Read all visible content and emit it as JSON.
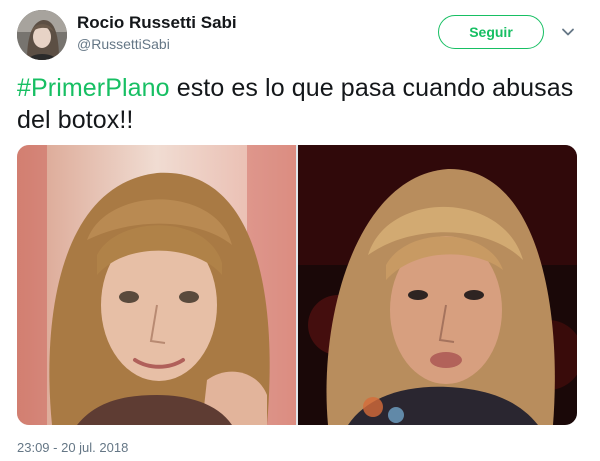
{
  "author": {
    "display_name": "Rocio Russetti Sabi",
    "handle": "@RussettiSabi",
    "avatar_icon": "user-avatar-photo"
  },
  "follow_button": {
    "label": "Seguir"
  },
  "menu": {
    "icon": "chevron-down-icon"
  },
  "tweet": {
    "hashtag": "#PrimerPlano",
    "text": " esto es lo que pasa cuando abusas del botox!!"
  },
  "media": {
    "photos": [
      {
        "icon": "portrait-photo-left"
      },
      {
        "icon": "portrait-photo-right"
      }
    ]
  },
  "meta": {
    "timestamp": "23:09 - 20 jul. 2018"
  },
  "colors": {
    "accent": "#17bf63",
    "text": "#14171a",
    "secondary": "#657786"
  }
}
